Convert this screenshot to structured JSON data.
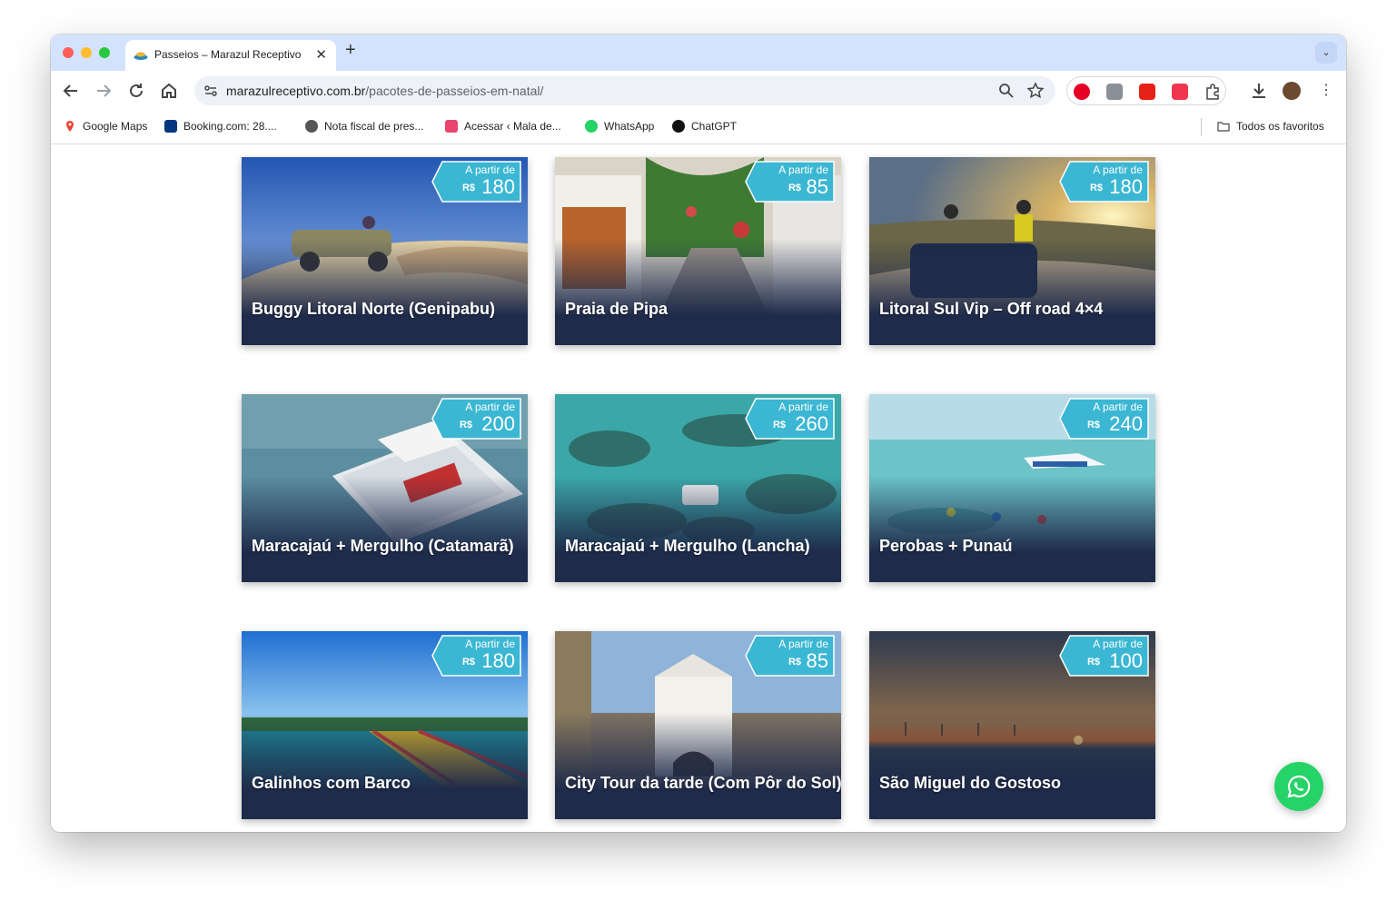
{
  "browser": {
    "tab_title": "Passeios – Marazul Receptivo",
    "url_domain": "marazulreceptivo.com.br",
    "url_path": "/pacotes-de-passeios-em-natal/",
    "icons": [
      "back-icon",
      "forward-icon",
      "reload-icon",
      "home-icon",
      "site-info-icon",
      "zoom-icon",
      "star-icon",
      "pinterest-icon",
      "m-extension-icon",
      "youtube-extension-icon",
      "dice-extension-icon",
      "puzzle-icon",
      "download-icon",
      "profile-avatar",
      "more-vert-icon",
      "whatsapp-icon"
    ]
  },
  "bookmarks": [
    {
      "label": "Google Maps"
    },
    {
      "label": "Booking.com: 28...."
    },
    {
      "label": "Nota fiscal de pres..."
    },
    {
      "label": "Acessar ‹ Mala de..."
    },
    {
      "label": "WhatsApp"
    },
    {
      "label": "ChatGPT"
    }
  ],
  "all_bookmarks_label": "Todos os favoritos",
  "price_prefix": "A partir de",
  "currency": "R$",
  "accent_color": "#3bb7d3",
  "card_bar_color": "#1f2b4a",
  "tours": [
    {
      "title": "Buggy Litoral Norte (Genipabu)",
      "price": "180"
    },
    {
      "title": "Praia de Pipa",
      "price": "85"
    },
    {
      "title": "Litoral Sul Vip – Off road 4×4",
      "price": "180"
    },
    {
      "title": "Maracajaú + Mergulho (Catamarã)",
      "price": "200"
    },
    {
      "title": "Maracajaú + Mergulho (Lancha)",
      "price": "260"
    },
    {
      "title": "Perobas + Punaú",
      "price": "240"
    },
    {
      "title": "Galinhos com Barco",
      "price": "180"
    },
    {
      "title": "City Tour da tarde (Com Pôr do Sol)",
      "price": "85"
    },
    {
      "title": "São Miguel do Gostoso",
      "price": "100"
    }
  ]
}
